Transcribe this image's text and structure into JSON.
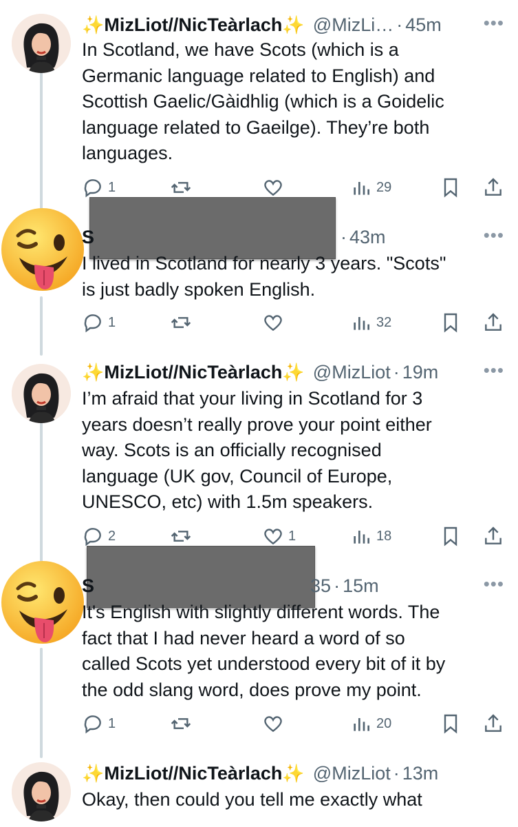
{
  "tweets": [
    {
      "name": "MizLiot//NicTeàrlach",
      "handle": "@MizLi…",
      "time": "45m",
      "text": "In Scotland, we have Scots (which is a\nGermanic language related to English) and\nScottish Gaelic/Gàidhlig (which is a Goidelic\nlanguage related to Gaeilge). They’re both\nlanguages.",
      "replies": "1",
      "retweets": "",
      "likes": "",
      "views": "29"
    },
    {
      "name": "S",
      "handle": "",
      "time": "43m",
      "text": "I lived in Scotland for nearly 3 years. \"Scots\"\nis just badly spoken English.",
      "replies": "1",
      "retweets": "",
      "likes": "",
      "views": "32"
    },
    {
      "name": "MizLiot//NicTeàrlach",
      "handle": "@MizLiot",
      "time": "19m",
      "text": "I’m afraid that your living in Scotland for 3\nyears doesn’t really prove your point either\nway. Scots is an officially recognised\nlanguage (UK gov, Council of Europe,\nUNESCO, etc) with 1.5m speakers.",
      "replies": "2",
      "retweets": "",
      "likes": "1",
      "views": "18"
    },
    {
      "name": "S",
      "handle": "35",
      "time": "15m",
      "text": "It's English with slightly different words. The\nfact that I had never heard a word of so\ncalled Scots yet understood every bit of it by\nthe odd slang word, does prove my point.",
      "replies": "1",
      "retweets": "",
      "likes": "",
      "views": "20"
    },
    {
      "name": "MizLiot//NicTeàrlach",
      "handle": "@MizLiot",
      "time": "13m",
      "text": "Okay, then could you tell me exactly what",
      "replies": "",
      "retweets": "",
      "likes": "",
      "views": ""
    }
  ],
  "symbols": {
    "sparkle": "✨",
    "dot": "·",
    "more": "•••"
  },
  "icons": [
    "reply-icon",
    "retweet-icon",
    "like-icon",
    "views-icon",
    "bookmark-icon",
    "share-icon",
    "more-icon",
    "winking-tongue-emoji"
  ],
  "colors": {
    "text": "#0f1419",
    "secondary": "#536471",
    "thread_line": "#cfd9de",
    "redaction": "#6b6b6b"
  }
}
